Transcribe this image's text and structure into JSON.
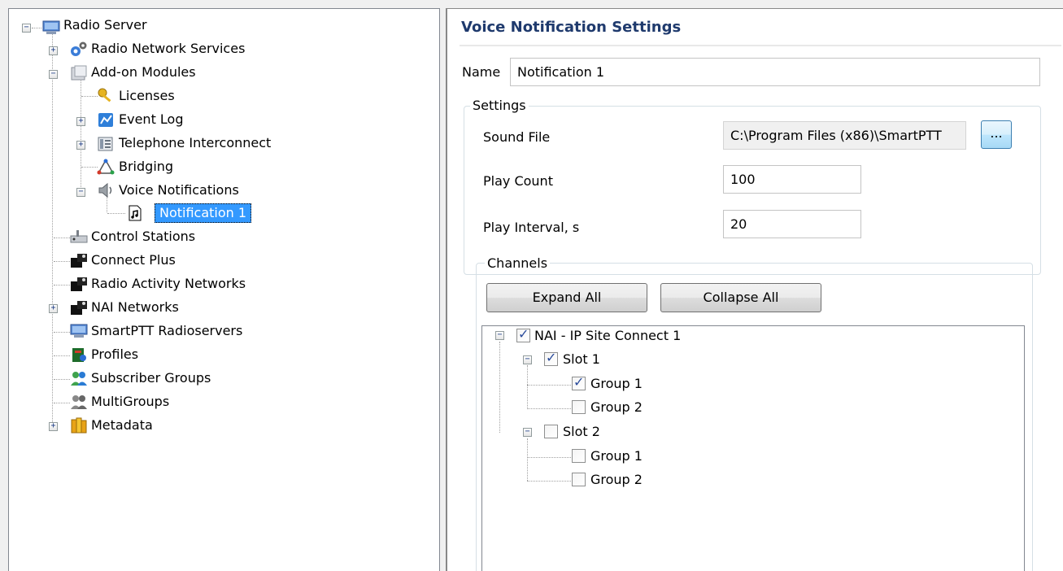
{
  "tree": {
    "root_label": "Radio Server",
    "items": [
      {
        "label": "Radio Network Services"
      },
      {
        "label": "Add-on Modules"
      },
      {
        "label": "Licenses"
      },
      {
        "label": "Event Log"
      },
      {
        "label": "Telephone Interconnect"
      },
      {
        "label": "Bridging"
      },
      {
        "label": "Voice Notifications"
      },
      {
        "label": "Notification 1"
      },
      {
        "label": "Control Stations"
      },
      {
        "label": "Connect Plus"
      },
      {
        "label": "Radio Activity Networks"
      },
      {
        "label": "NAI Networks"
      },
      {
        "label": "SmartPTT Radioservers"
      },
      {
        "label": "Profiles"
      },
      {
        "label": "Subscriber Groups"
      },
      {
        "label": "MultiGroups"
      },
      {
        "label": "Metadata"
      }
    ]
  },
  "panel": {
    "title": "Voice Notification Settings",
    "name_label": "Name",
    "name_value": "Notification 1",
    "settings_legend": "Settings",
    "sound_file_label": "Sound File",
    "sound_file_value": "C:\\Program Files (x86)\\SmartPTT",
    "browse_label": "...",
    "play_count_label": "Play Count",
    "play_count_value": "100",
    "play_interval_label": "Play Interval, s",
    "play_interval_value": "20",
    "channels_legend": "Channels",
    "expand_all_label": "Expand All",
    "collapse_all_label": "Collapse All"
  },
  "channels": {
    "network": {
      "label": "NAI - IP Site Connect 1",
      "checked": true
    },
    "slot1": {
      "label": "Slot 1",
      "checked": true
    },
    "slot1_group1": {
      "label": "Group 1",
      "checked": true
    },
    "slot1_group2": {
      "label": "Group 2",
      "checked": false
    },
    "slot2": {
      "label": "Slot 2",
      "checked": false
    },
    "slot2_group1": {
      "label": "Group 1",
      "checked": false
    },
    "slot2_group2": {
      "label": "Group 2",
      "checked": false
    }
  }
}
